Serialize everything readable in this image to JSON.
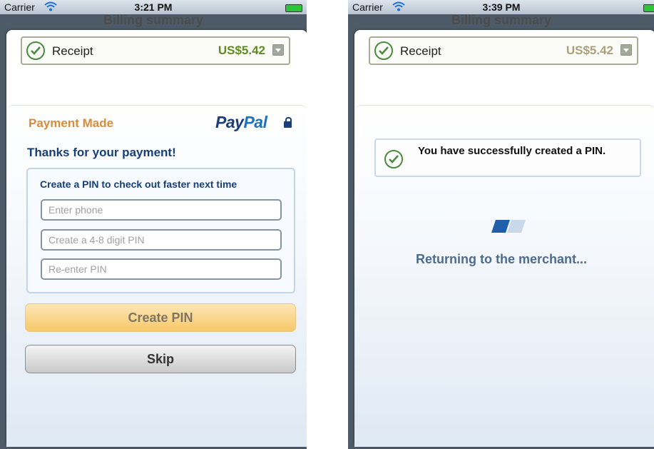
{
  "left_screen": {
    "status_bar": {
      "carrier": "Carrier",
      "time": "3:21 PM",
      "wifi_icon": "wifi-icon",
      "battery_icon": "battery-icon"
    },
    "title": "Billing summary",
    "receipt": {
      "label": "Receipt",
      "amount": "US$5.42"
    },
    "payment_made": "Payment Made",
    "logo": {
      "pay": "Pay",
      "pal": "Pal"
    },
    "thanks": "Thanks for your payment!",
    "pin_form": {
      "heading": "Create a PIN to check out faster next time",
      "phone_placeholder": "Enter phone",
      "pin_placeholder": "Create a 4-8 digit PIN",
      "pin_confirm_placeholder": "Re-enter PIN"
    },
    "create_pin_label": "Create PIN",
    "skip_label": "Skip"
  },
  "right_screen": {
    "status_bar": {
      "carrier": "Carrier",
      "time": "3:39 PM",
      "wifi_icon": "wifi-icon",
      "battery_icon": "battery-icon"
    },
    "title": "Billing summary",
    "receipt": {
      "label": "Receipt",
      "amount": "US$5.42"
    },
    "success_message": "You have successfully created a PIN.",
    "returning_text": "Returning to the merchant..."
  },
  "colors": {
    "amount_green": "#5d8c1f",
    "amount_muted": "#a9a07c",
    "payment_made_orange": "#d58c3e",
    "heading_navy": "#163f77",
    "create_button": "#f7c867"
  }
}
